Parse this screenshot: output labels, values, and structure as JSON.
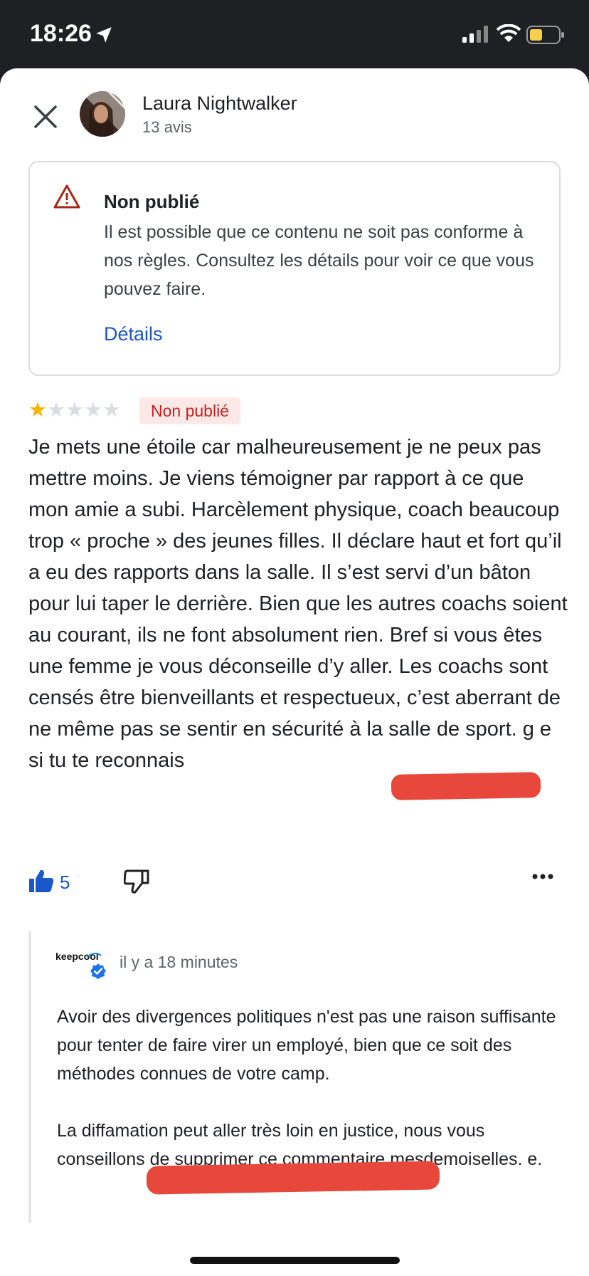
{
  "status_bar": {
    "time": "18:26"
  },
  "header": {
    "user_name": "Laura Nightwalker",
    "review_count": "13 avis"
  },
  "notice": {
    "title": "Non publié",
    "text": "Il est possible que ce contenu ne soit pas conforme à nos règles. Consultez les détails pour voir ce que vous pouvez faire.",
    "link": "Détails"
  },
  "review": {
    "rating": 1,
    "max_rating": 5,
    "badge": "Non publié",
    "body": "Je mets une étoile car malheureusement je ne peux pas mettre moins. Je viens témoigner par rapport à ce que mon amie a subi. Harcèlement physique, coach beaucoup trop « proche » des jeunes filles. Il déclare haut et fort qu’il a eu des rapports dans la salle. Il s’est servi d’un bâton pour lui taper le derrière. Bien que les autres coachs soient au courant, ils ne font absolument rien. Bref si vous êtes une femme je vous déconseille d’y aller. Les coachs sont censés être bienveillants et respectueux, c’est aberrant de ne même pas se sentir en sécurité à la salle de sport. g  e si tu te reconnais",
    "likes": "5"
  },
  "owner_reply": {
    "logo_text": "keepcool",
    "time": "il y a 18 minutes",
    "paragraph_1": "Avoir des divergences politiques n'est pas une raison suffisante pour tenter de faire virer un employé, bien que ce soit des méthodes connues de votre camp.",
    "paragraph_2": "La diffamation peut aller très loin en justice, nous vous conseillons de supprimer ce commentaire mesdemoiselles.                             e."
  },
  "colors": {
    "accent_blue": "#1a57c9",
    "star_gold": "#f6b400",
    "badge_red": "#c5221f",
    "badge_bg": "#fce8e6",
    "redaction": "#e8473b"
  },
  "icons": {
    "close": "close-icon",
    "warning": "warning-icon",
    "like": "thumbs-up-icon",
    "dislike": "thumbs-down-icon",
    "more": "more-horizontal-icon",
    "verified": "verified-badge-icon"
  }
}
